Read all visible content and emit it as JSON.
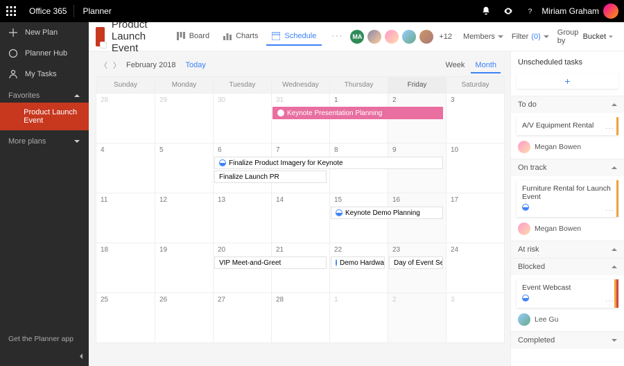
{
  "topbar": {
    "brand": "Office 365",
    "app": "Planner",
    "user_name": "Miriam Graham"
  },
  "leftnav": {
    "new_plan": "New Plan",
    "planner_hub": "Planner Hub",
    "my_tasks": "My Tasks",
    "favorites_label": "Favorites",
    "more_plans_label": "More plans",
    "selected_plan": "Product Launch Event",
    "footer": "Get the Planner app"
  },
  "plan": {
    "title": "Product Launch Event",
    "tabs": {
      "board": "Board",
      "charts": "Charts",
      "schedule": "Schedule"
    },
    "more_members": "+12",
    "members_label": "Members",
    "filter_label": "Filter",
    "filter_count": "(0)",
    "groupby_label": "Group by",
    "groupby_value": "Bucket"
  },
  "cal": {
    "month_label": "February 2018",
    "today_label": "Today",
    "view_week": "Week",
    "view_month": "Month",
    "dow": [
      "Sunday",
      "Monday",
      "Tuesday",
      "Wednesday",
      "Thursday",
      "Friday",
      "Saturday"
    ],
    "weeks": [
      [
        "28",
        "29",
        "30",
        "31",
        "1",
        "2",
        "3"
      ],
      [
        "4",
        "5",
        "6",
        "7",
        "8",
        "9",
        "10"
      ],
      [
        "11",
        "12",
        "13",
        "14",
        "15",
        "16",
        "17"
      ],
      [
        "18",
        "19",
        "20",
        "21",
        "22",
        "23",
        "24"
      ],
      [
        "25",
        "26",
        "27",
        "28",
        "1",
        "2",
        "3"
      ]
    ],
    "events": {
      "keynote_planning": "Keynote Presentation Planning",
      "finalize_imagery": "Finalize Product Imagery for Keynote",
      "finalize_pr": "Finalize Launch PR",
      "keynote_demo_plan": "Keynote Demo Planning",
      "vip_meet": "VIP Meet-and-Greet",
      "demo_hw": "Demo Hardware",
      "day_of_setup": "Day of Event Setup"
    }
  },
  "right": {
    "header": "Unscheduled tasks",
    "buckets": {
      "todo": "To do",
      "ontrack": "On track",
      "atrisk": "At risk",
      "blocked": "Blocked",
      "completed": "Completed"
    },
    "tasks": {
      "av_rental": "A/V Equipment Rental",
      "furniture_rental": "Furniture Rental for Launch Event",
      "event_webcast": "Event Webcast"
    },
    "people": {
      "megan": "Megan Bowen",
      "lee": "Lee Gu"
    }
  }
}
